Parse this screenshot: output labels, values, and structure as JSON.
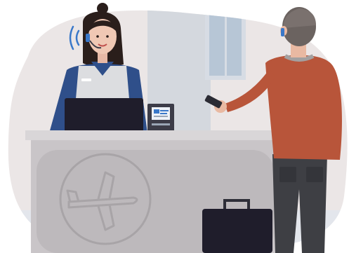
{
  "illustration": {
    "kiosk_screen_text": "",
    "colors": {
      "backdrop": "#ebe6e6",
      "window_frame": "#d7dce4",
      "window_glass": "#9fb3c9",
      "counter_top": "#d9d6d8",
      "counter_front": "#c9c5c8",
      "counter_panel": "#bdb9bc",
      "plane_emblem": "#a8a4a7",
      "agent_shirt": "#2f4f8a",
      "agent_vest": "#dcdde0",
      "agent_hair": "#2a1e1b",
      "agent_skin": "#f0c8b4",
      "laptop": "#1f1d2b",
      "traveler_sweater": "#b8553a",
      "traveler_pants": "#3e3f44",
      "traveler_hair": "#6b6360",
      "traveler_skin": "#e9b9a2",
      "headset_accent": "#3a78c9",
      "suitcase": "#1f1d2b",
      "phone": "#2b2b33"
    }
  }
}
